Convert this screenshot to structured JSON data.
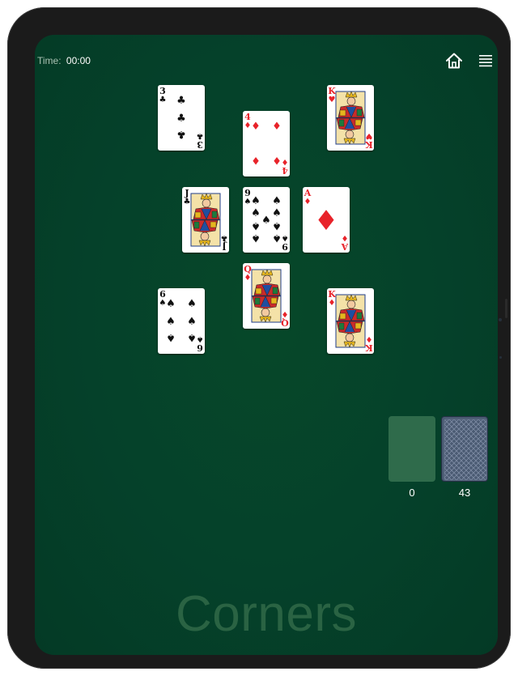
{
  "header": {
    "time_label": "Time:",
    "time_value": "00:00"
  },
  "icons": {
    "home": "home-icon",
    "menu": "hamburger-menu-icon"
  },
  "colors": {
    "felt": "#05412a",
    "red": "#e8232a",
    "black": "#111111",
    "title": "#2a6343"
  },
  "cards": [
    {
      "name": "card-3-clubs",
      "rank": "3",
      "suit": "clubs"
    },
    {
      "name": "card-4-diamonds",
      "rank": "4",
      "suit": "diamonds"
    },
    {
      "name": "card-k-hearts",
      "rank": "K",
      "suit": "hearts"
    },
    {
      "name": "card-j-clubs",
      "rank": "J",
      "suit": "clubs"
    },
    {
      "name": "card-9-spades",
      "rank": "9",
      "suit": "spades"
    },
    {
      "name": "card-a-diamonds",
      "rank": "A",
      "suit": "diamonds"
    },
    {
      "name": "card-q-diamonds",
      "rank": "Q",
      "suit": "diamonds"
    },
    {
      "name": "card-6-spades",
      "rank": "6",
      "suit": "spades"
    },
    {
      "name": "card-k-diamonds",
      "rank": "K",
      "suit": "diamonds"
    }
  ],
  "piles": {
    "waste_count": "0",
    "stock_count": "43"
  },
  "title": "Corners"
}
